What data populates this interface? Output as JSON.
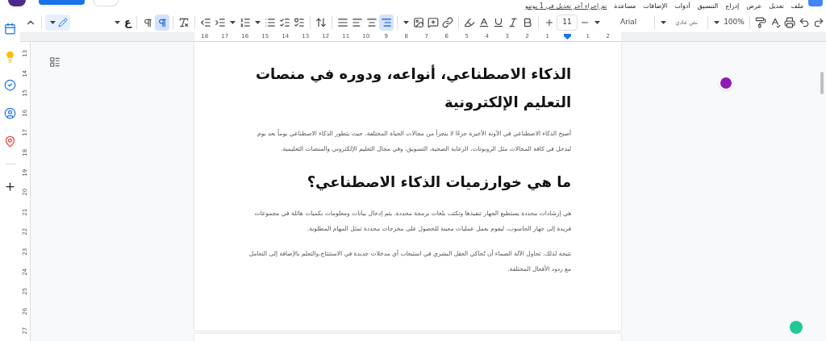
{
  "menu": [
    "ملف",
    "تعديل",
    "عرض",
    "إدراج",
    "التنسيق",
    "أدوات",
    "الإضافات",
    "مساعدة"
  ],
  "last_edit": "تم إجراء آخر تعديل في 1 يونيو",
  "toolbar": {
    "editing_mode": {
      "selected": true
    },
    "input_tool": "ع",
    "direction": [
      {
        "selected": false
      },
      {
        "selected": true
      }
    ],
    "align": [
      {
        "selected": false
      },
      {
        "selected": false
      },
      {
        "selected": false
      },
      {
        "selected": true
      }
    ],
    "font_size": "11",
    "font": "Arial",
    "style": "نص عادي",
    "zoom": "100%"
  },
  "ruler_top": {
    "after_indent": [
      "2",
      "1"
    ],
    "before_indent": [
      "1",
      "2",
      "3",
      "4",
      "5",
      "6",
      "7",
      "8",
      "9",
      "10",
      "11",
      "12",
      "13",
      "14",
      "15",
      "16",
      "17",
      "18"
    ]
  },
  "ruler_side": [
    "13",
    "14",
    "15",
    "16",
    "17",
    "18",
    "19",
    "20",
    "21",
    "22",
    "23",
    "24",
    "25",
    "26",
    "27"
  ],
  "document": {
    "blocks": [
      {
        "kind": "heading",
        "text": "الذكاء الاصطناعي، أنواعه، ودوره في منصات التعليم الإلكترونية"
      },
      {
        "kind": "paragraph",
        "text": "أصبح الذكاء الاصطناعي في الآونة الأخيرة جزءًا لا يتجزأ من مجالات الحياة المختلفة. حيث يتطور الذكاء الاصطناعي يوماً بعد يوم ليدخل في كافة المجالات مثل الروبوتات، الرعاية الصحية، التسويق، وفي مجال التعليم الإلكتروني والمنصات التعليمية."
      },
      {
        "kind": "heading",
        "text": "ما هي خوارزميات الذكاء الاصطناعي؟"
      },
      {
        "kind": "paragraph",
        "text": "هي إرشادات محددة يستطيع الجهاز تنفيذها وتكتب بلغات برمجة محددة. يتم إدخال بيانات ومعلومات بكميات هائلة في مجموعات فريدة إلى جهاز الحاسوب، ليقوم بعمل عمليات معينة للحصول على مخرجات محددة تمثل المهام المطلوبة."
      },
      {
        "kind": "paragraph",
        "text": "نتيجة لذلك، تحاول الآلة الصماء أن تُحاكي العقل البشري في استيعاب أي مدخلات جديدة في الاستنتاج،والتعلم بالإضافة إلى التعامل مع ردود الأفعال المختلفة."
      }
    ]
  }
}
